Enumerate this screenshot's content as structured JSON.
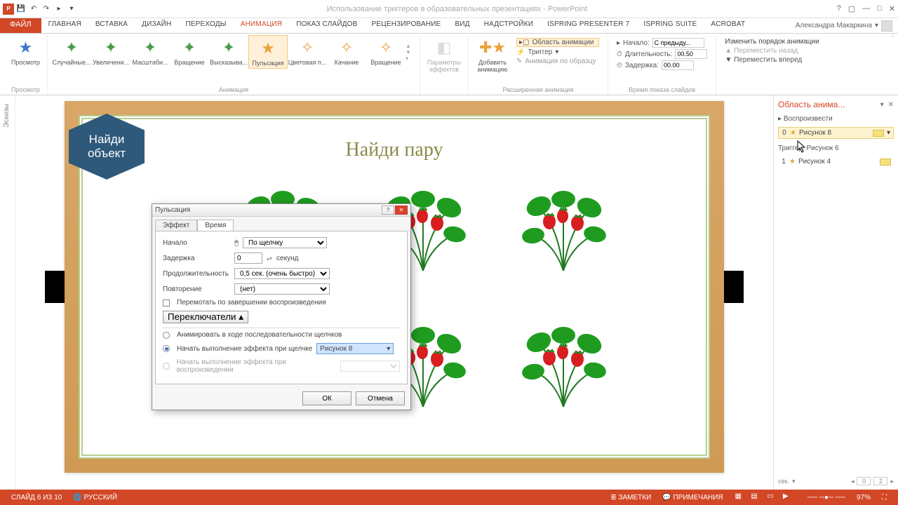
{
  "titlebar": {
    "doc": "Использование триггеров в образовательных презентациях - PowerPoint"
  },
  "tabs": {
    "file": "ФАЙЛ",
    "list": [
      "ГЛАВНАЯ",
      "ВСТАВКА",
      "ДИЗАЙН",
      "ПЕРЕХОДЫ",
      "АНИМАЦИЯ",
      "ПОКАЗ СЛАЙДОВ",
      "РЕЦЕНЗИРОВАНИЕ",
      "ВИД",
      "НАДСТРОЙКИ",
      "ISPRING PRESENTER 7",
      "iSpring Suite",
      "ACROBAT"
    ],
    "active": 4,
    "user": "Александра Макаркина"
  },
  "ribbon": {
    "preview": "Просмотр",
    "preview_group": "Просмотр",
    "effects_group": "Анимация",
    "effects": [
      "Случайные...",
      "Увеличени...",
      "Масштаби...",
      "Вращение",
      "Высказыва...",
      "Пульсация",
      "Цветовая п...",
      "Качание",
      "Вращение"
    ],
    "active_effect": 5,
    "effopts": "Параметры эффектов",
    "addanim": "Добавить анимацию",
    "adv_group": "Расширенная анимация",
    "pane": "Область анимации",
    "trigger": "Триггер",
    "painter": "Анимация по образцу",
    "start_lbl": "Начало:",
    "start_val": "С предыду...",
    "dur_lbl": "Длительность:",
    "dur_val": "00.50",
    "delay_lbl": "Задержка:",
    "delay_val": "00.00",
    "timing_group": "Время показа слайдов",
    "reorder_hdr": "Изменить порядок анимации",
    "reorder_up": "Переместить назад",
    "reorder_down": "Переместить вперед"
  },
  "leftrail": {
    "thumbs": "Эскизы"
  },
  "slide": {
    "title": "Найди пару",
    "hex": "Найди объект"
  },
  "apane": {
    "title": "Область анима...",
    "play": "Воспроизвести",
    "item1": "Рисунок 8",
    "trigger_hdr": "Триггер: Рисунок 6",
    "item2": "Рисунок 4",
    "sec": "сек.",
    "n0": "0",
    "n2": "2"
  },
  "dialog": {
    "title": "Пульсация",
    "tab1": "Эффект",
    "tab2": "Время",
    "l_start": "Начало",
    "v_start": "По щелчку",
    "l_delay": "Задержка",
    "v_delay": "0",
    "u_delay": "секунд",
    "l_dur": "Продолжительность",
    "v_dur": "0,5 сек. (очень быстро)",
    "l_repeat": "Повторение",
    "v_repeat": "(нет)",
    "chk_rewind": "Перемотать по завершении воспроизведения",
    "triggers_btn": "Переключатели",
    "r1": "Анимировать в ходе последовательности щелчков",
    "r2": "Начать выполнение эффекта при щелчке",
    "r2_obj": "Рисунок 8",
    "r3_lbl": "Начать выполнение эффекта при воспроизведении",
    "ok": "ОК",
    "cancel": "Отмена"
  },
  "status": {
    "slide": "СЛАЙД 6 ИЗ 10",
    "lang": "РУССКИЙ",
    "notes": "ЗАМЕТКИ",
    "comments": "ПРИМЕЧАНИЯ",
    "zoom": "97%"
  }
}
